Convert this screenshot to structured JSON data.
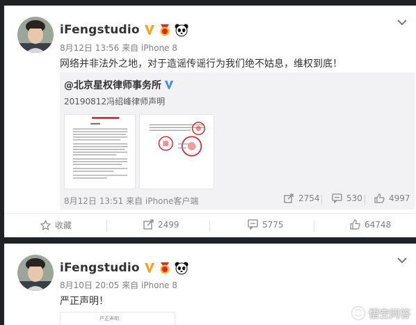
{
  "posts": [
    {
      "username": "iFengstudio",
      "meta": "8月12日 13:56 来自 iPhone 8",
      "text": "网络并非法外之地，对于造谣传谣行为我们绝不姑息，维权到底！",
      "repost": {
        "username": "@北京星权律师事务所",
        "text": "20190812冯绍峰律师声明",
        "meta": "8月12日 13:51 来自 iPhone客户端",
        "stats": {
          "forward": "2754",
          "comment": "530",
          "like": "4997"
        }
      },
      "actions": {
        "favorite": "收藏",
        "forward": "2499",
        "comment": "5775",
        "like": "64748"
      }
    },
    {
      "username": "iFengstudio",
      "meta": "8月10日 20:05 来自 iPhone 8",
      "text": "严正声明！",
      "doc_preview": "严正声明"
    }
  ],
  "watermark": "悟空问答",
  "colors": {
    "verified": "#f9a11b",
    "text": "#333333",
    "meta": "#808080",
    "repost_bg": "#f2f2f5",
    "page_bg": "#202122",
    "seal": "#e0242b"
  }
}
